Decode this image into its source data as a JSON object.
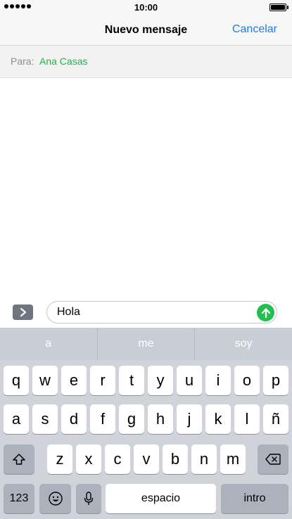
{
  "status_bar": {
    "time": "10:00"
  },
  "nav": {
    "title": "Nuevo mensaje",
    "cancel_label": "Cancelar"
  },
  "recipient": {
    "label": "Para:",
    "name": "Ana Casas"
  },
  "compose": {
    "message_value": "Hola"
  },
  "predictive": [
    "a",
    "me",
    "soy"
  ],
  "keyboard": {
    "row1": [
      "q",
      "w",
      "e",
      "r",
      "t",
      "y",
      "u",
      "i",
      "o",
      "p"
    ],
    "row2": [
      "a",
      "s",
      "d",
      "f",
      "g",
      "h",
      "j",
      "k",
      "l",
      "ñ"
    ],
    "row3": [
      "z",
      "x",
      "c",
      "v",
      "b",
      "n",
      "m"
    ],
    "numbers_label": "123",
    "space_label": "espacio",
    "return_label": "intro"
  },
  "colors": {
    "accent": "#1a7ef5",
    "recipient": "#22b24c",
    "send": "#21bf4d"
  }
}
